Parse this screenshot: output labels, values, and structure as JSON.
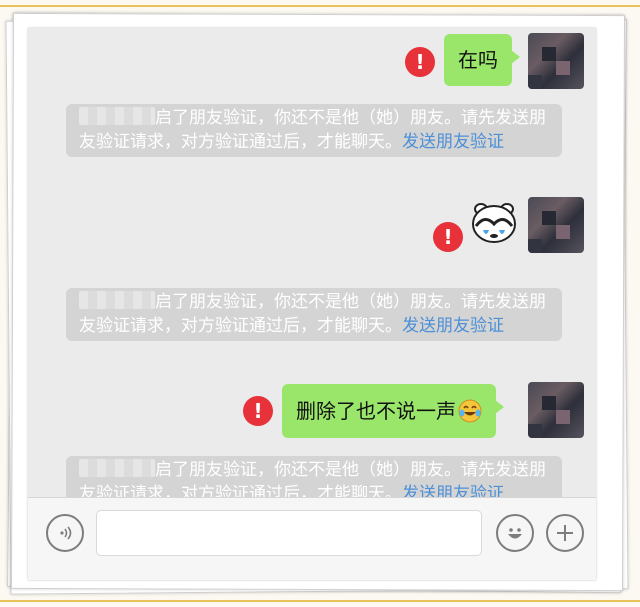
{
  "messages": [
    {
      "text": "在吗",
      "status_icon": "exclamation-error-icon"
    },
    {
      "sticker": "covering-face-bear-sticker",
      "status_icon": "exclamation-error-icon"
    },
    {
      "text": "删除了也不说一声",
      "emoji": "laugh-cry-emoji",
      "status_icon": "exclamation-error-icon"
    }
  ],
  "notice": {
    "text": "启了朋友验证，你还不是他（她）朋友。请先发送朋友验证请求，对方验证通过后，才能聊天。",
    "link": "发送朋友验证"
  },
  "glyphs": {
    "error": "!"
  },
  "input_bar": {
    "voice_icon": "voice-icon",
    "input_placeholder": "",
    "emoji_icon": "emoji-icon",
    "plus_icon": "plus-icon"
  },
  "colors": {
    "bubble": "#9ae66b",
    "error": "#e8323a",
    "link": "#4d8fd6",
    "notice_bg": "#d4d4d4"
  }
}
